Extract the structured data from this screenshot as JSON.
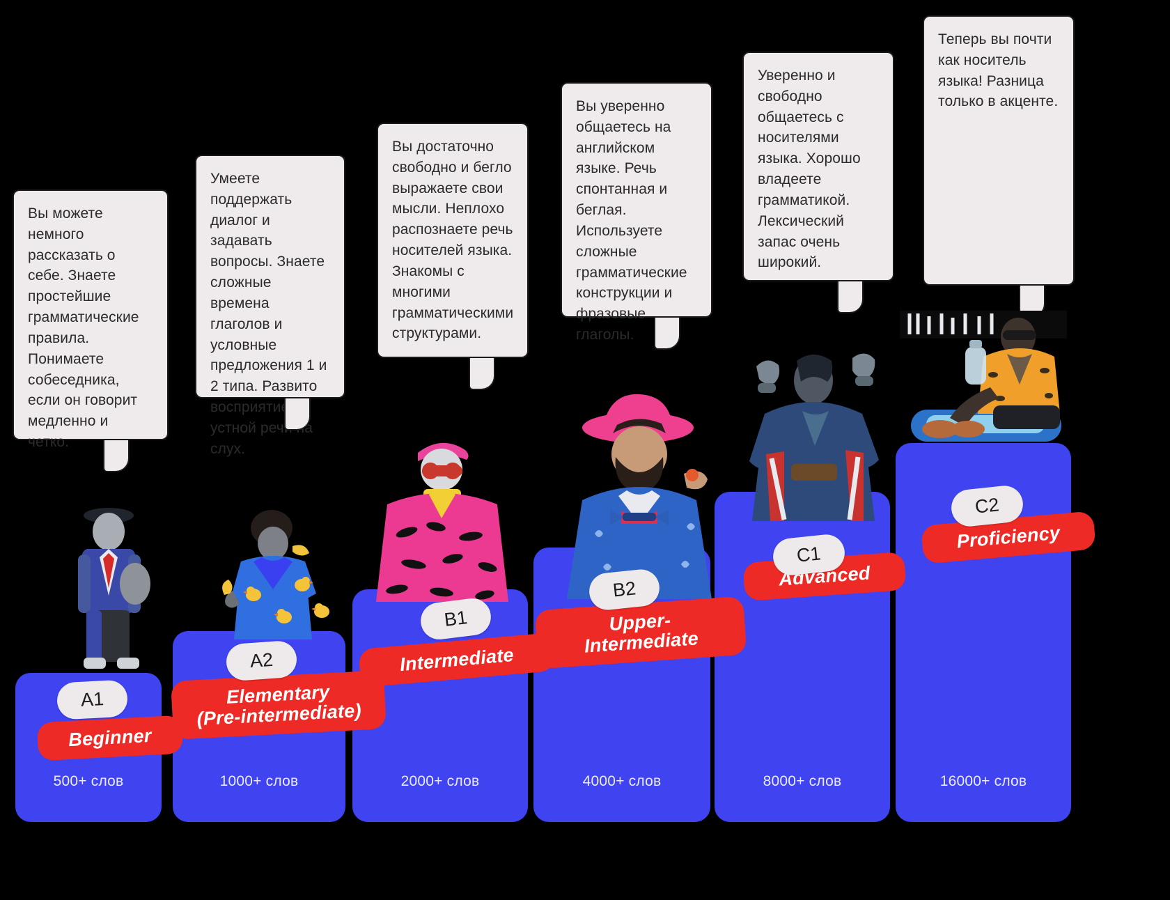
{
  "palette": {
    "background": "#000000",
    "card_blue": "#3f43f0",
    "badge_red": "#ee2a26",
    "bubble_gray": "#efeaec",
    "bubble_border": "#1a1a1a",
    "text_dark": "#2b2b2b",
    "text_light": "#eceaf8"
  },
  "levels": [
    {
      "cefr": "A1",
      "name": "Beginner",
      "words": "500+ слов",
      "description": "Вы можете немного рассказать о себе. Знаете простейшие грамматические правила. Понимаете собеседника, если он говорит медленно и четко.",
      "figure": "businessman-bowler-hat-figure"
    },
    {
      "cefr": "A2",
      "name": "Elementary\n(Pre-intermediate)",
      "words": "1000+ слов",
      "description": "Умеете поддержать диалог и задавать вопросы. Знаете сложные времена глаголов и условные предложения 1 и 2 типа. Развито восприятие устной речи на слух.",
      "figure": "person-blue-robe-ducks-figure"
    },
    {
      "cefr": "B1",
      "name": "Intermediate",
      "words": "2000+ слов",
      "description": "Вы достаточно свободно и бегло выражаете свои мысли. Неплохо распознаете речь носителей языка. Знакомы с многими грамматическими структурами.",
      "figure": "person-pink-coat-sunglasses-figure"
    },
    {
      "cefr": "B2",
      "name": "Upper-\nIntermediate",
      "words": "4000+ слов",
      "description": "Вы уверенно общаетесь на английском языке. Речь спонтанная и беглая. Используете сложные грамматические конструкции и фразовые глаголы.",
      "figure": "person-pink-hat-bowtie-figure"
    },
    {
      "cefr": "C1",
      "name": "Advanced",
      "words": "8000+ слов",
      "description": "Уверенно и свободно общаетесь с носителями языка. Хорошо владеете грамматикой. Лексический запас очень широкий.",
      "figure": "person-blue-cloak-hands-figure"
    },
    {
      "cefr": "C2",
      "name": "Proficiency",
      "words": "16000+ слов",
      "description": "Теперь вы почти как носитель языка! Разница только в акценте.",
      "figure": "person-orange-shirt-pool-float-figure"
    }
  ]
}
